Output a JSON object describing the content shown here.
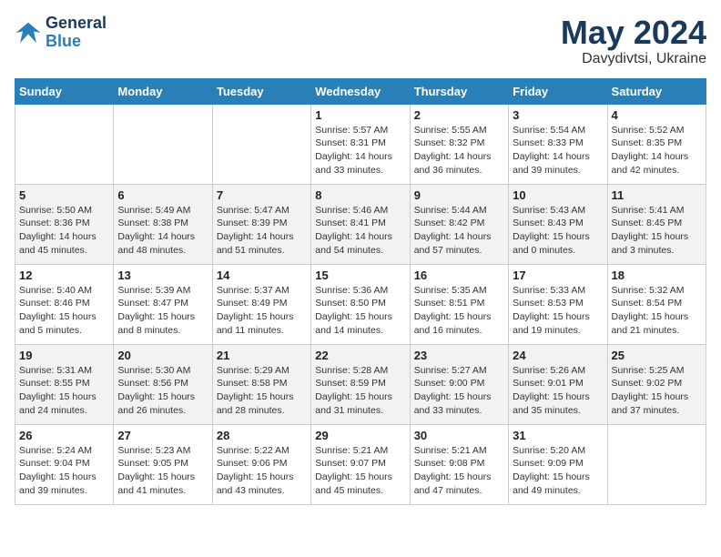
{
  "logo": {
    "line1": "General",
    "line2": "Blue"
  },
  "title": "May 2024",
  "location": "Davydivtsi, Ukraine",
  "days_of_week": [
    "Sunday",
    "Monday",
    "Tuesday",
    "Wednesday",
    "Thursday",
    "Friday",
    "Saturday"
  ],
  "weeks": [
    [
      {
        "num": "",
        "info": ""
      },
      {
        "num": "",
        "info": ""
      },
      {
        "num": "",
        "info": ""
      },
      {
        "num": "1",
        "info": "Sunrise: 5:57 AM\nSunset: 8:31 PM\nDaylight: 14 hours\nand 33 minutes."
      },
      {
        "num": "2",
        "info": "Sunrise: 5:55 AM\nSunset: 8:32 PM\nDaylight: 14 hours\nand 36 minutes."
      },
      {
        "num": "3",
        "info": "Sunrise: 5:54 AM\nSunset: 8:33 PM\nDaylight: 14 hours\nand 39 minutes."
      },
      {
        "num": "4",
        "info": "Sunrise: 5:52 AM\nSunset: 8:35 PM\nDaylight: 14 hours\nand 42 minutes."
      }
    ],
    [
      {
        "num": "5",
        "info": "Sunrise: 5:50 AM\nSunset: 8:36 PM\nDaylight: 14 hours\nand 45 minutes."
      },
      {
        "num": "6",
        "info": "Sunrise: 5:49 AM\nSunset: 8:38 PM\nDaylight: 14 hours\nand 48 minutes."
      },
      {
        "num": "7",
        "info": "Sunrise: 5:47 AM\nSunset: 8:39 PM\nDaylight: 14 hours\nand 51 minutes."
      },
      {
        "num": "8",
        "info": "Sunrise: 5:46 AM\nSunset: 8:41 PM\nDaylight: 14 hours\nand 54 minutes."
      },
      {
        "num": "9",
        "info": "Sunrise: 5:44 AM\nSunset: 8:42 PM\nDaylight: 14 hours\nand 57 minutes."
      },
      {
        "num": "10",
        "info": "Sunrise: 5:43 AM\nSunset: 8:43 PM\nDaylight: 15 hours\nand 0 minutes."
      },
      {
        "num": "11",
        "info": "Sunrise: 5:41 AM\nSunset: 8:45 PM\nDaylight: 15 hours\nand 3 minutes."
      }
    ],
    [
      {
        "num": "12",
        "info": "Sunrise: 5:40 AM\nSunset: 8:46 PM\nDaylight: 15 hours\nand 5 minutes."
      },
      {
        "num": "13",
        "info": "Sunrise: 5:39 AM\nSunset: 8:47 PM\nDaylight: 15 hours\nand 8 minutes."
      },
      {
        "num": "14",
        "info": "Sunrise: 5:37 AM\nSunset: 8:49 PM\nDaylight: 15 hours\nand 11 minutes."
      },
      {
        "num": "15",
        "info": "Sunrise: 5:36 AM\nSunset: 8:50 PM\nDaylight: 15 hours\nand 14 minutes."
      },
      {
        "num": "16",
        "info": "Sunrise: 5:35 AM\nSunset: 8:51 PM\nDaylight: 15 hours\nand 16 minutes."
      },
      {
        "num": "17",
        "info": "Sunrise: 5:33 AM\nSunset: 8:53 PM\nDaylight: 15 hours\nand 19 minutes."
      },
      {
        "num": "18",
        "info": "Sunrise: 5:32 AM\nSunset: 8:54 PM\nDaylight: 15 hours\nand 21 minutes."
      }
    ],
    [
      {
        "num": "19",
        "info": "Sunrise: 5:31 AM\nSunset: 8:55 PM\nDaylight: 15 hours\nand 24 minutes."
      },
      {
        "num": "20",
        "info": "Sunrise: 5:30 AM\nSunset: 8:56 PM\nDaylight: 15 hours\nand 26 minutes."
      },
      {
        "num": "21",
        "info": "Sunrise: 5:29 AM\nSunset: 8:58 PM\nDaylight: 15 hours\nand 28 minutes."
      },
      {
        "num": "22",
        "info": "Sunrise: 5:28 AM\nSunset: 8:59 PM\nDaylight: 15 hours\nand 31 minutes."
      },
      {
        "num": "23",
        "info": "Sunrise: 5:27 AM\nSunset: 9:00 PM\nDaylight: 15 hours\nand 33 minutes."
      },
      {
        "num": "24",
        "info": "Sunrise: 5:26 AM\nSunset: 9:01 PM\nDaylight: 15 hours\nand 35 minutes."
      },
      {
        "num": "25",
        "info": "Sunrise: 5:25 AM\nSunset: 9:02 PM\nDaylight: 15 hours\nand 37 minutes."
      }
    ],
    [
      {
        "num": "26",
        "info": "Sunrise: 5:24 AM\nSunset: 9:04 PM\nDaylight: 15 hours\nand 39 minutes."
      },
      {
        "num": "27",
        "info": "Sunrise: 5:23 AM\nSunset: 9:05 PM\nDaylight: 15 hours\nand 41 minutes."
      },
      {
        "num": "28",
        "info": "Sunrise: 5:22 AM\nSunset: 9:06 PM\nDaylight: 15 hours\nand 43 minutes."
      },
      {
        "num": "29",
        "info": "Sunrise: 5:21 AM\nSunset: 9:07 PM\nDaylight: 15 hours\nand 45 minutes."
      },
      {
        "num": "30",
        "info": "Sunrise: 5:21 AM\nSunset: 9:08 PM\nDaylight: 15 hours\nand 47 minutes."
      },
      {
        "num": "31",
        "info": "Sunrise: 5:20 AM\nSunset: 9:09 PM\nDaylight: 15 hours\nand 49 minutes."
      },
      {
        "num": "",
        "info": ""
      }
    ]
  ]
}
